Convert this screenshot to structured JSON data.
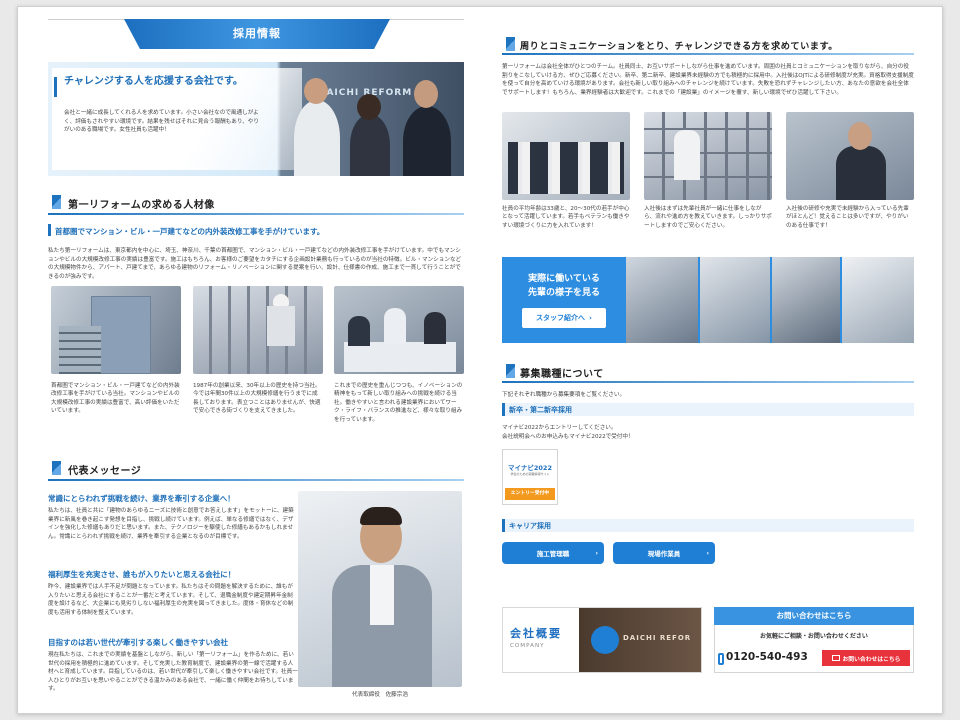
{
  "header": {
    "tab_label": "採用情報"
  },
  "hero": {
    "title": "チャレンジする人を応援する会社です。",
    "text": "会社と一緒に成長してくれる人を求めています。小さい会社なので風通しがよく、評価もされやすい環境です。結果を残せばそれに見合う報酬もあり、やりがいのある職場です。女性社員も活躍中！",
    "sign_text": "DAICHI REFORM"
  },
  "left_section1": {
    "title": "第一リフォームの求める人材像",
    "subheading": "首都圏でマンション・ビル・一戸建てなどの内外装改修工事を手がけています。",
    "body": "私たち第一リフォームは、東京都内を中心に、埼玉、神奈川、千葉の首都圏で、マンション・ビル・一戸建てなどの内外装改修工事を手がけています。中でもマンションやビルの大規模改修工事の実績は豊富です。施工はもちろん、お客様のご要望をカタチにする企画設計業務も行っているのが当社の特徴。ビル・マンションなどの大規模物件から、アパート、戸建てまで、あらゆる建物のリフォーム・リノベーションに関する提案を行い、設計、仕様書の作成、施工まで一貫して行うことができるのが強みです。",
    "captions": [
      "首都圏でマンション・ビル・一戸建てなどの内外装改修工事を手がけている当社。マンションやビルの大規模改修工事の実績は豊富で、高い評価をいただいています。",
      "1987年の創業以来、30年以上の歴史を持つ当社。今では年間30件以上の大規模修繕を行うまでに成長しております。表立つことはありませんが、快適で安心できる街づくりを支えてきました。",
      "これまでの歴史を重んじつつも、イノベーションの精神をもって新しい取り組みへの挑戦を続ける当社。働きやすいと言われる建設業界においてワーク・ライフ・バランスの推進など、様々な取り組みを行っています。"
    ]
  },
  "left_section2": {
    "title": "代表メッセージ",
    "blocks": [
      {
        "heading": "常識にとらわれず挑戦を続け、業界を牽引する企業へ！",
        "body": "私たちは、社員と共に「建物のあらゆるニーズに技術と創意でお答えします」をモットーに、建築業界に新風を巻き起こす発想を目指し、挑戦し続けています。例えば、単なる修繕ではなく、デザインを強化した修繕もありだと思います。また、テクノロジーを駆使した修繕もあるかもしれません。常識にとらわれず挑戦を続け、業界を牽引する企業となるのが目標です。"
      },
      {
        "heading": "福利厚生を充実させ、誰もが入りたいと思える会社に！",
        "body": "昨今、建設業界では人手不足が問題となっています。私たちはその問題を解決するために、誰もが入りたいと思える会社にすることが一番だと考えています。そして、退職金制度や建定期昇年金制度を設けるなど、大企業にも見劣りしない福利厚生の充実を図ってきました。度体・育休などの制度も活用する体制を整えています。"
      },
      {
        "heading": "目指すのは若い世代が牽引する楽しく働きやすい会社",
        "body": "現在私たちは、これまでの実績を基盤としながら、新しい「第一リフォーム」を作るために、若い世代の採用を積極的に進めています。そして充実した教育制度で、建設業界の第一線で活躍する人材へと育成しています。目指しているのは、若い世代が牽引して楽しく働きやすい会社です。社員一人ひとりがお互いを思いやることができる温かみのある会社で、一緒に働く仲間をお待ちしています。"
      }
    ],
    "photo_caption": "代表取締役　佐藤宗浩"
  },
  "right_section1": {
    "title": "周りとコミュニケーションをとり、チャレンジできる方を求めています。",
    "body": "第一リフォームは会社全体がひとつのチーム。社員同士、お互いサポートしながら仕事を進めています。周囲の社員とコミュニケーションを取りながら、自分の役割りをこなしていける方、ぜひご応募ください。新卒、第二新卒、建設業界未経験の方でも積極的に採用中。入社後はOJTによる研修制度が充実。資格取得支援制度を使って自分を高めていける環境があります。会社も新しい取り組みへのチャレンジを続けています。失敗を恐れずチャレンジしたい方、あなたの意欲を会社全体でサポートします！もちろん、業界経験者は大歓迎です。これまでの「建設業」のイメージを覆す、新しい環境でぜひ活躍して下さい。",
    "captions": [
      "社員の平均年齢は33歳と、20〜30代の若手が中心となって活躍しています。若手もベテランも働きやすい環境づくりに力を入れています！",
      "入社後はまずは先輩社員が一緒に仕事をしながら、流れや進め方を教えていきます。しっかりサポートしますのでご安心ください。",
      "入社後の研修や充実で未経験から入っている先輩がほとんど！覚えることは多いですが、やりがいのある仕事です！"
    ]
  },
  "staff_banner": {
    "line1": "実際に働いている",
    "line2": "先輩の様子を見る",
    "button": "スタッフ紹介へ"
  },
  "recruit": {
    "title": "募集職種について",
    "intro": "下記それぞれ職種から募集要項をご覧ください。",
    "newgrad_heading": "新卒・第二新卒採用",
    "newgrad_text1": "マイナビ2022からエントリーしてください。",
    "newgrad_text2": "会社説明会へのお申込みもマイナビ2022で受付中！",
    "mynavi_logo": "マイナビ2022",
    "mynavi_sub": "学生のための就職情報サイト",
    "mynavi_entry": "エントリー受付中",
    "career_heading": "キャリア採用",
    "career_buttons": [
      "施工管理職",
      "現場作業員"
    ]
  },
  "company_banner": {
    "title": "会社概要",
    "sub": "COMPANY",
    "sign": "DAICHI REFOR"
  },
  "contact": {
    "header": "お問い合わせはこちら",
    "sub": "お気軽にご相談・お問い合わせください",
    "phone": "0120-540-493",
    "button": "お問い合わせはこちら"
  },
  "colors": {
    "accent": "#1e73be",
    "button": "#1f7fd4",
    "contact_red": "#e8323c"
  }
}
